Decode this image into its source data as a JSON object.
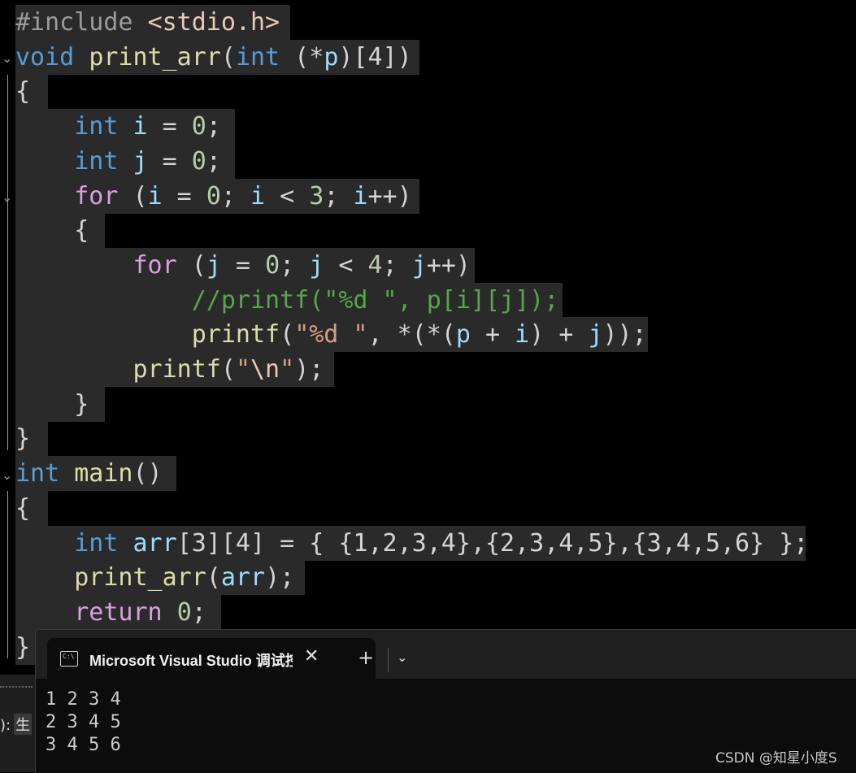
{
  "editor": {
    "lines": [
      [
        {
          "t": "#include ",
          "c": "pp"
        },
        {
          "t": "<stdio.h>",
          "c": "inc"
        }
      ],
      [
        {
          "t": "void",
          "c": "kw"
        },
        {
          "t": " "
        },
        {
          "t": "print_arr",
          "c": "fn"
        },
        {
          "t": "("
        },
        {
          "t": "int",
          "c": "kw"
        },
        {
          "t": " (*"
        },
        {
          "t": "p",
          "c": "var"
        },
        {
          "t": ")[4])"
        }
      ],
      [
        {
          "t": "{"
        }
      ],
      [
        {
          "t": "    "
        },
        {
          "t": "int",
          "c": "kw"
        },
        {
          "t": " "
        },
        {
          "t": "i",
          "c": "var"
        },
        {
          "t": " = "
        },
        {
          "t": "0",
          "c": "num"
        },
        {
          "t": ";"
        }
      ],
      [
        {
          "t": "    "
        },
        {
          "t": "int",
          "c": "kw"
        },
        {
          "t": " "
        },
        {
          "t": "j",
          "c": "var"
        },
        {
          "t": " = "
        },
        {
          "t": "0",
          "c": "num"
        },
        {
          "t": ";"
        }
      ],
      [
        {
          "t": "    "
        },
        {
          "t": "for",
          "c": "ctl"
        },
        {
          "t": " ("
        },
        {
          "t": "i",
          "c": "var"
        },
        {
          "t": " = "
        },
        {
          "t": "0",
          "c": "num"
        },
        {
          "t": "; "
        },
        {
          "t": "i",
          "c": "var"
        },
        {
          "t": " < "
        },
        {
          "t": "3",
          "c": "num"
        },
        {
          "t": "; "
        },
        {
          "t": "i",
          "c": "var"
        },
        {
          "t": "++)"
        }
      ],
      [
        {
          "t": "    {"
        }
      ],
      [
        {
          "t": "        "
        },
        {
          "t": "for",
          "c": "ctl"
        },
        {
          "t": " ("
        },
        {
          "t": "j",
          "c": "var"
        },
        {
          "t": " = "
        },
        {
          "t": "0",
          "c": "num"
        },
        {
          "t": "; "
        },
        {
          "t": "j",
          "c": "var"
        },
        {
          "t": " < "
        },
        {
          "t": "4",
          "c": "num"
        },
        {
          "t": "; "
        },
        {
          "t": "j",
          "c": "var"
        },
        {
          "t": "++)"
        }
      ],
      [
        {
          "t": "            "
        },
        {
          "t": "//printf(\"%d \", p[i][j]);",
          "c": "cmt"
        }
      ],
      [
        {
          "t": "            "
        },
        {
          "t": "printf",
          "c": "fn"
        },
        {
          "t": "("
        },
        {
          "t": "\"%d \"",
          "c": "str"
        },
        {
          "t": ", *(*("
        },
        {
          "t": "p",
          "c": "var"
        },
        {
          "t": " + "
        },
        {
          "t": "i",
          "c": "var"
        },
        {
          "t": ") + "
        },
        {
          "t": "j",
          "c": "var"
        },
        {
          "t": "));"
        }
      ],
      [
        {
          "t": "        "
        },
        {
          "t": "printf",
          "c": "fn"
        },
        {
          "t": "("
        },
        {
          "t": "\"",
          "c": "str"
        },
        {
          "t": "\\n",
          "c": "esc"
        },
        {
          "t": "\"",
          "c": "str"
        },
        {
          "t": ");"
        }
      ],
      [
        {
          "t": "    }"
        }
      ],
      [
        {
          "t": "}"
        }
      ],
      [
        {
          "t": "int",
          "c": "kw"
        },
        {
          "t": " "
        },
        {
          "t": "main",
          "c": "fn"
        },
        {
          "t": "()"
        }
      ],
      [
        {
          "t": "{"
        }
      ],
      [
        {
          "t": "    "
        },
        {
          "t": "int",
          "c": "kw"
        },
        {
          "t": " "
        },
        {
          "t": "arr",
          "c": "var"
        },
        {
          "t": "[3][4] = { {1,2,3,4},{2,3,4,5},{3,4,5,6} };"
        }
      ],
      [
        {
          "t": "    "
        },
        {
          "t": "print_arr",
          "c": "fn"
        },
        {
          "t": "("
        },
        {
          "t": "arr",
          "c": "var"
        },
        {
          "t": ");"
        }
      ],
      [
        {
          "t": "    "
        },
        {
          "t": "return",
          "c": "ctl"
        },
        {
          "t": " "
        },
        {
          "t": "0",
          "c": "num"
        },
        {
          "t": ";"
        }
      ],
      [
        {
          "t": "}"
        }
      ]
    ]
  },
  "terminal": {
    "tab_title": "Microsoft Visual Studio 调试控制台",
    "close_glyph": "✕",
    "new_tab_glyph": "+",
    "dropdown_glyph": "⌄",
    "output": "1 2 3 4\n2 3 4 5\n3 4 5 6"
  },
  "status": {
    "fragment_prefix": "):",
    "fragment_box": "生"
  },
  "watermark": "CSDN @知星小度S"
}
